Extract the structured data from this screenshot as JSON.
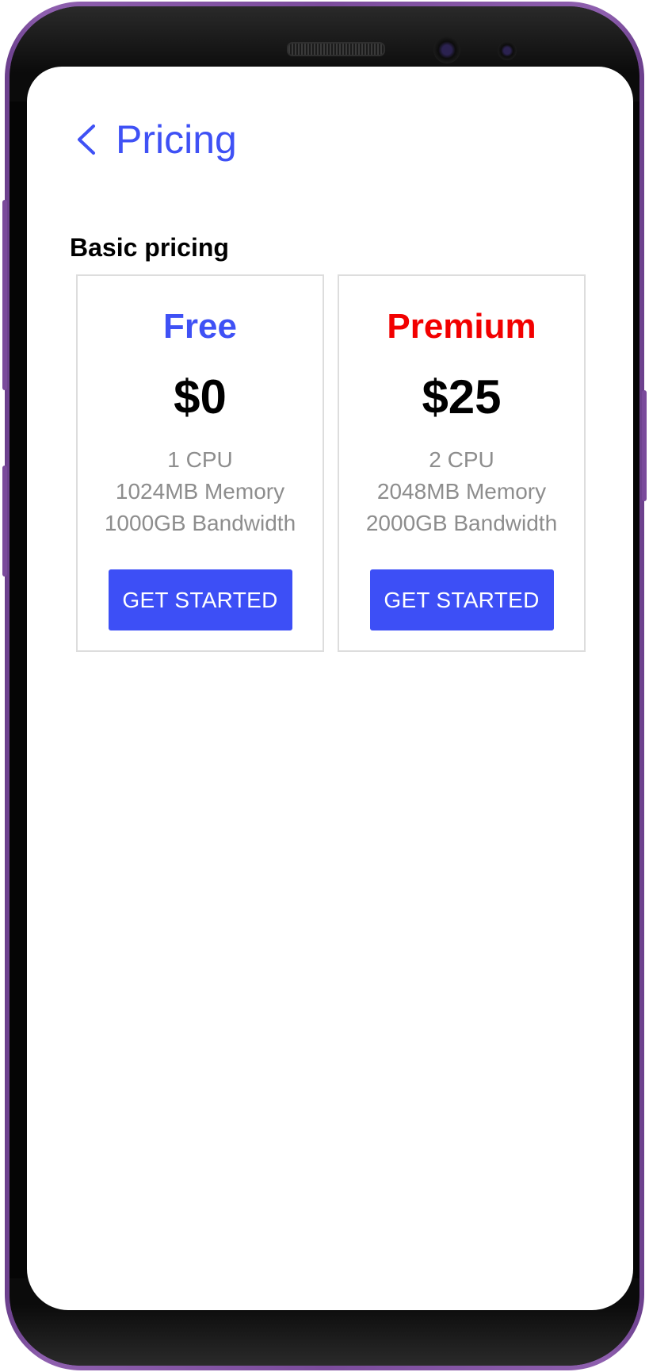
{
  "header": {
    "title": "Pricing",
    "back_icon": "chevron-left-icon"
  },
  "section": {
    "label": "Basic pricing"
  },
  "plans": [
    {
      "name": "Free",
      "name_color": "#3F51F5",
      "price": "$0",
      "features": [
        "1 CPU",
        "1024MB Memory",
        "1000GB Bandwidth"
      ],
      "cta_label": "GET STARTED"
    },
    {
      "name": "Premium",
      "name_color": "#F20000",
      "price": "$25",
      "features": [
        "2 CPU",
        "2048MB Memory",
        "2000GB Bandwidth"
      ],
      "cta_label": "GET STARTED"
    }
  ],
  "colors": {
    "accent": "#3D4FF6",
    "device_frame": "#7B4C9C"
  }
}
